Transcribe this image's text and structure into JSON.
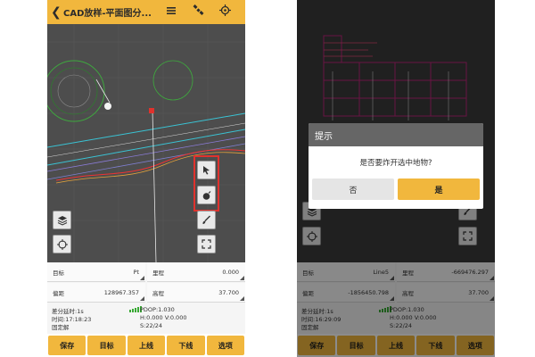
{
  "left": {
    "header": {
      "back_icon": "back-arrow-icon",
      "title": "CAD放样-平面图分...",
      "icons": [
        "menu-list-icon",
        "satellite-icon",
        "gps-target-icon"
      ]
    },
    "fields": [
      {
        "label": "目标",
        "value": "Pt"
      },
      {
        "label": "里程",
        "value": "0.000"
      },
      {
        "label": "偏距",
        "value": "128967.357"
      },
      {
        "label": "高程",
        "value": "37.700"
      }
    ],
    "status": {
      "diff_delay": "差分延时:1s",
      "time": "时间:17:18:23",
      "solution": "固定解",
      "pdop": "PDOP:1.030",
      "hv": "H:0.000  V:0.000",
      "sats": "S:22/24"
    },
    "toolbar": [
      "保存",
      "目标",
      "上线",
      "下线",
      "选项"
    ]
  },
  "right": {
    "fields": [
      {
        "label": "目标",
        "value": "Line5"
      },
      {
        "label": "里程",
        "value": "-669476.297"
      },
      {
        "label": "偏距",
        "value": "-1856450.798"
      },
      {
        "label": "高程",
        "value": "37.700"
      }
    ],
    "status": {
      "diff_delay": "差分延时:1s",
      "time": "时间:16:29:09",
      "solution": "固定解",
      "pdop": "PDOP:1.030",
      "hv": "H:0.000  V:0.000",
      "sats": "S:22/24"
    },
    "toolbar": [
      "保存",
      "目标",
      "上线",
      "下线",
      "选项"
    ],
    "dialog": {
      "title": "提示",
      "message": "是否要炸开选中地物?",
      "no": "否",
      "yes": "是"
    }
  },
  "colors": {
    "accent": "#f1b73d",
    "highlight": "#e0322d",
    "map_bg": "#4d4d4d"
  }
}
